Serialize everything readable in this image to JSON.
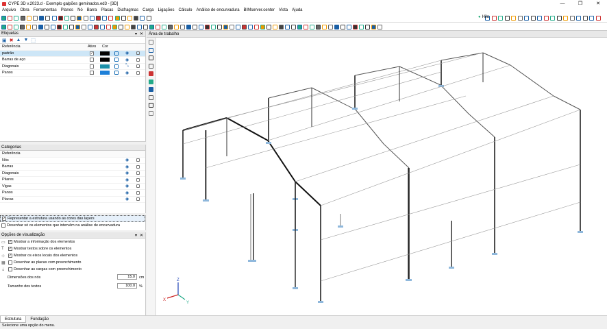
{
  "window": {
    "title": "CYPE 3D v.2023.d - Exemplo galpões geminados.ed3 - [3D]",
    "controls": [
      "—",
      "❐",
      "✕"
    ]
  },
  "menu": {
    "items": [
      "Arquivo",
      "Obra",
      "Ferramentas",
      "Planos",
      "Nó",
      "Barra",
      "Placas",
      "Diafragmas",
      "Carga",
      "Ligações",
      "Cálculo",
      "Análise de encurvadura",
      "BIMserver.center",
      "Vista",
      "Ajuda"
    ]
  },
  "toolbar": {
    "help_label": "Hilo"
  },
  "labels_panel": {
    "title": "Etiquetas",
    "columns": {
      "reference": "Referência",
      "active": "Ativo",
      "color": "Cor"
    },
    "rows": [
      {
        "name": "padrão",
        "active": "✓",
        "color": "#000000"
      },
      {
        "name": "Barras de aço",
        "active": "",
        "color": "#000000"
      },
      {
        "name": "Diagonais",
        "active": "",
        "color": "#1b8fa8"
      },
      {
        "name": "Panos",
        "active": "",
        "color": "#1d7fd8"
      }
    ]
  },
  "categories_panel": {
    "title": "Categorias",
    "column": "Referência",
    "rows": [
      "Nós",
      "Barras",
      "Diagonais",
      "Pilares",
      "Vigas",
      "Panos",
      "Placas"
    ]
  },
  "checks": {
    "layers_colors": "Representar a estrutura usando as cores das layers",
    "only_buckling": "Desenhar só os elementos que intervêm na análise de encurvadura"
  },
  "view_options": {
    "title": "Opções de visualização",
    "items": [
      "Mostrar a informação dos elementos",
      "Mostrar textos sobre os elementos",
      "Mostrar os eixos locais dos elementos",
      "Desenhar as placas com preenchimento",
      "Desenhar as cargas com preenchimento"
    ],
    "node_dim_label": "Dimensões dos nós",
    "node_dim_value": "15.0",
    "node_dim_unit": "cm",
    "text_size_label": "Tamanho dos textos",
    "text_size_value": "100.0",
    "text_size_unit": "%"
  },
  "workarea": {
    "title": "Área de trabalho"
  },
  "axes": {
    "x": "X",
    "y": "Y",
    "z": "Z"
  },
  "tabs": [
    "Estrutura",
    "Fundação"
  ],
  "status": "Selecione uma opção do menu."
}
